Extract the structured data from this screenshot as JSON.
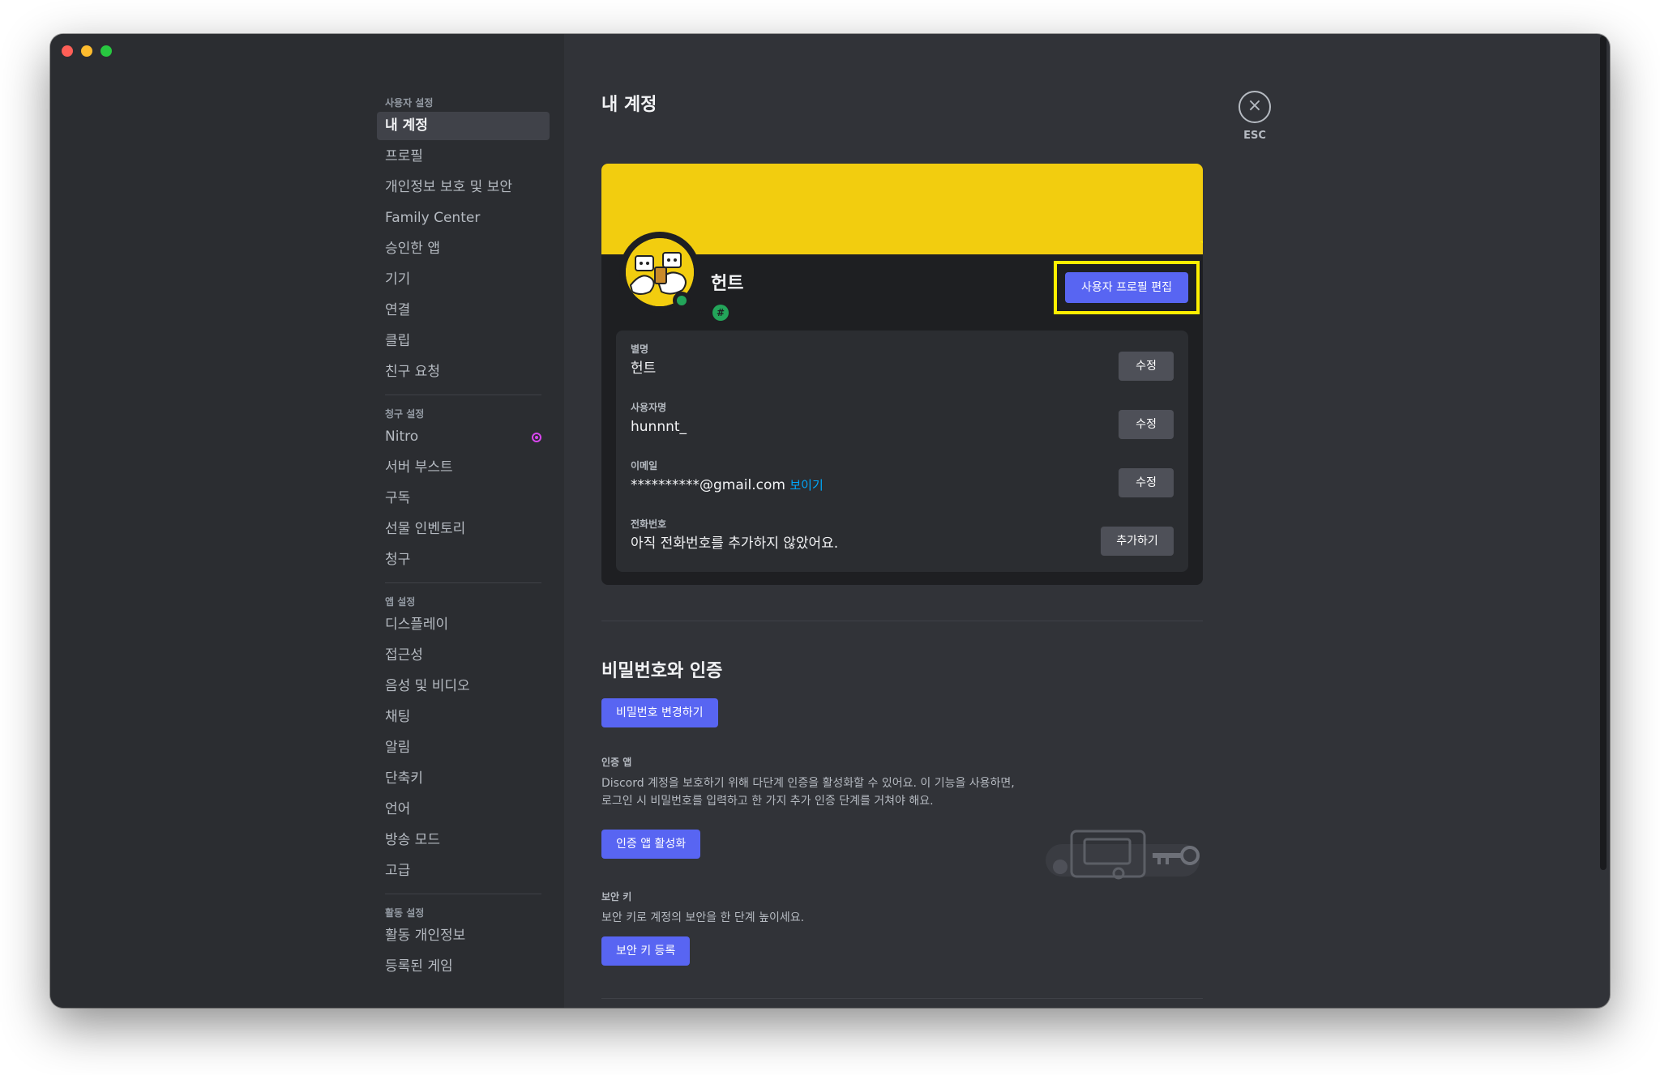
{
  "sidebar": {
    "sections": [
      {
        "header": "사용자 설정",
        "items": [
          "내 계정",
          "프로필",
          "개인정보 보호 및 보안",
          "Family Center",
          "승인한 앱",
          "기기",
          "연결",
          "클립",
          "친구 요청"
        ]
      },
      {
        "header": "청구 설정",
        "items": [
          "Nitro",
          "서버 부스트",
          "구독",
          "선물 인벤토리",
          "청구"
        ]
      },
      {
        "header": "앱 설정",
        "items": [
          "디스플레이",
          "접근성",
          "음성 및 비디오",
          "채팅",
          "알림",
          "단축키",
          "언어",
          "방송 모드",
          "고급"
        ]
      },
      {
        "header": "활동 설정",
        "items": [
          "활동 개인정보",
          "등록된 게임"
        ]
      }
    ],
    "active_item": "내 계정"
  },
  "main": {
    "title": "내 계정",
    "profile": {
      "display_name": "헌트",
      "badge": "#",
      "edit_button": "사용자 프로필 편집",
      "banner_color": "#f2cd0f"
    },
    "fields": {
      "nickname": {
        "label": "별명",
        "value": "헌트",
        "button": "수정"
      },
      "username": {
        "label": "사용자명",
        "value": "hunnnt_",
        "button": "수정"
      },
      "email": {
        "label": "이메일",
        "value": "**********@gmail.com",
        "reveal": "보이기",
        "button": "수정"
      },
      "phone": {
        "label": "전화번호",
        "value": "아직 전화번호를 추가하지 않았어요.",
        "button": "추가하기"
      }
    },
    "security": {
      "title": "비밀번호와 인증",
      "change_password_button": "비밀번호 변경하기",
      "auth_app_label": "인증 앱",
      "auth_app_desc_line1": "Discord 계정을 보호하기 위해 다단계 인증을 활성화할 수 있어요. 이 기능을 사용하면,",
      "auth_app_desc_line2": "로그인 시 비밀번호를 입력하고 한 가지 추가 인증 단계를 거쳐야 해요.",
      "auth_app_button": "인증 앱 활성화",
      "security_key_label": "보안 키",
      "security_key_desc": "보안 키로 계정의 보안을 한 단계 높이세요.",
      "security_key_button": "보안 키 등록"
    }
  },
  "close": {
    "label": "ESC"
  },
  "colors": {
    "accent": "#5865f2",
    "highlight": "#ffee00",
    "online": "#23a55a",
    "banner": "#f2cd0f"
  }
}
